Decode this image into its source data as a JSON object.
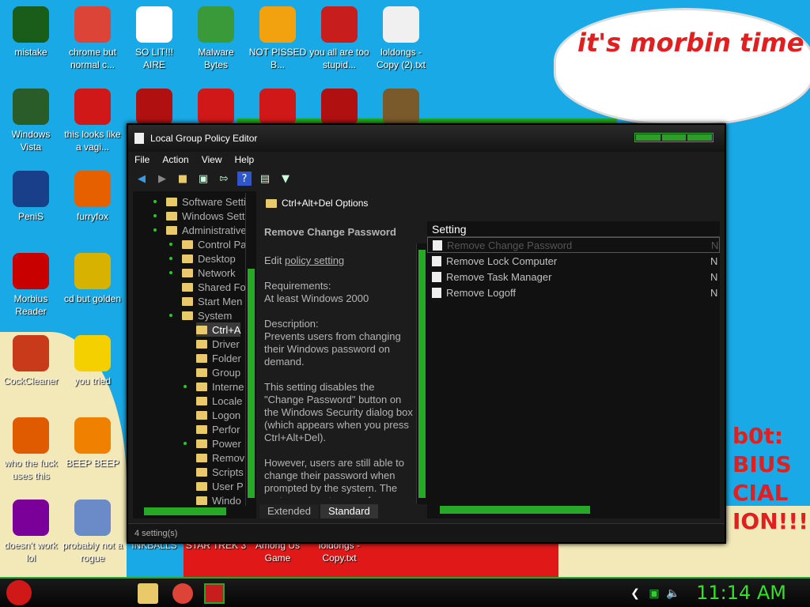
{
  "desktop": {
    "bubble_text": "it's morbin time",
    "red_lines": [
      "b0t:",
      "BIUS",
      "CIAL",
      "ION!!!"
    ],
    "icons": [
      {
        "label": "mistake",
        "icon": "green-orb-icon",
        "color": "#1a5c1a"
      },
      {
        "label": "chrome but normal c...",
        "icon": "chrome-icon",
        "color": "#db4437"
      },
      {
        "label": "SO LIT!!! AIRE",
        "icon": "solitaire-icon",
        "color": "#ffffff"
      },
      {
        "label": "Malware Bytes",
        "icon": "shield-icon",
        "color": "#3a9a3a"
      },
      {
        "label": "NOT PISSED B...",
        "icon": "angry-pig-icon",
        "color": "#f2a20e"
      },
      {
        "label": "you all are too stupid...",
        "icon": "devcpp-icon",
        "color": "#c81d1d"
      },
      {
        "label": "loldongs - Copy (2).txt",
        "icon": "text-file-icon",
        "color": "#f0f0f0"
      },
      {
        "label": "Windows Vista",
        "icon": "recycle-icon",
        "color": "#2a5c2a"
      },
      {
        "label": "this looks like a vagi...",
        "icon": "opera-icon",
        "color": "#d01818"
      },
      {
        "label": "PeniS",
        "icon": "photoshop-icon",
        "color": "#1a3f8a"
      },
      {
        "label": "furryfox",
        "icon": "firefox-icon",
        "color": "#e66000"
      },
      {
        "label": "Morbius Reader",
        "icon": "pdf-icon",
        "color": "#c80000"
      },
      {
        "label": "cd but golden",
        "icon": "cd-icon",
        "color": "#d8b200"
      },
      {
        "label": "CockCleaner",
        "icon": "ccleaner-icon",
        "color": "#c83a1a"
      },
      {
        "label": "you tried",
        "icon": "star-icon",
        "color": "#f4d000"
      },
      {
        "label": "who the fuck uses this",
        "icon": "lightning-icon",
        "color": "#e05a00"
      },
      {
        "label": "BEEP BEEP",
        "icon": "vlc-icon",
        "color": "#f08000"
      },
      {
        "label": "doesn't work lol",
        "icon": "yahoo-icon",
        "color": "#7b0099"
      },
      {
        "label": "probably not a rogue",
        "icon": "gears-icon",
        "color": "#6a8ac8"
      },
      {
        "label": "INKBALLS",
        "icon": "inkball-icon",
        "color": "#333333"
      },
      {
        "label": "STAR TREK 3",
        "icon": "startrek-icon",
        "color": "#444444"
      },
      {
        "label": "Among Us Game",
        "icon": "amongus-icon",
        "color": "#c81d1d"
      },
      {
        "label": "loldongs - Copy.txt",
        "icon": "text-file-icon",
        "color": "#f0f0f0"
      },
      {
        "label": "",
        "icon": "flash-icon",
        "color": "#b01010"
      },
      {
        "label": "",
        "icon": "angry-bird-icon",
        "color": "#d01818"
      },
      {
        "label": "",
        "icon": "angry-bird-icon",
        "color": "#d01818"
      },
      {
        "label": "",
        "icon": "emblem-icon",
        "color": "#b01010"
      },
      {
        "label": "",
        "icon": "toolbox-icon",
        "color": "#7a5a2a"
      }
    ]
  },
  "window": {
    "title": "Local Group Policy Editor",
    "menu": [
      "File",
      "Action",
      "View",
      "Help"
    ],
    "toolbar": [
      "back-arrow-icon",
      "forward-arrow-icon",
      "folder-up-icon",
      "show-hide-icon",
      "export-list-icon",
      "help-icon",
      "properties-icon",
      "filter-icon"
    ],
    "tree": [
      {
        "label": "Software Setti",
        "depth": 0,
        "dot": true
      },
      {
        "label": "Windows Setti",
        "depth": 0,
        "dot": true
      },
      {
        "label": "Administrative",
        "depth": 0,
        "dot": true
      },
      {
        "label": "Control Pa",
        "depth": 1,
        "dot": true
      },
      {
        "label": "Desktop",
        "depth": 1,
        "dot": true
      },
      {
        "label": "Network",
        "depth": 1,
        "dot": true
      },
      {
        "label": "Shared Fo",
        "depth": 1,
        "dot": false
      },
      {
        "label": "Start Men",
        "depth": 1,
        "dot": false
      },
      {
        "label": "System",
        "depth": 1,
        "dot": true
      },
      {
        "label": "Ctrl+A",
        "depth": 2,
        "dot": false
      },
      {
        "label": "Driver",
        "depth": 2,
        "dot": false
      },
      {
        "label": "Folder",
        "depth": 2,
        "dot": false
      },
      {
        "label": "Group",
        "depth": 2,
        "dot": false
      },
      {
        "label": "Interne",
        "depth": 2,
        "dot": true
      },
      {
        "label": "Locale",
        "depth": 2,
        "dot": false
      },
      {
        "label": "Logon",
        "depth": 2,
        "dot": false
      },
      {
        "label": "Perfor",
        "depth": 2,
        "dot": false
      },
      {
        "label": "Power",
        "depth": 2,
        "dot": true
      },
      {
        "label": "Remov",
        "depth": 2,
        "dot": false
      },
      {
        "label": "Scripts",
        "depth": 2,
        "dot": false
      },
      {
        "label": "User P",
        "depth": 2,
        "dot": false
      },
      {
        "label": "Windo",
        "depth": 2,
        "dot": false
      }
    ],
    "breadcrumb": "Ctrl+Alt+Del Options",
    "description": {
      "heading": "Remove Change Password",
      "edit_prefix": "Edit ",
      "edit_link": "policy setting",
      "requirements": [
        "Requirements:",
        "At least Windows 2000"
      ],
      "description": [
        "Description:",
        "Prevents users from changing their Windows password on demand."
      ],
      "body1": "This setting disables the \"Change Password\" button on the Windows Security dialog box (which appears when you press Ctrl+Alt+Del).",
      "body2": "However, users are still able to change their password when prompted by the system. The system prompts users for a"
    },
    "list": {
      "column": "Setting",
      "state_col": "N",
      "items": [
        "Remove Change Password",
        "Remove Lock Computer",
        "Remove Task Manager",
        "Remove Logoff"
      ]
    },
    "tabs": [
      "Extended",
      "Standard"
    ],
    "status": "4 setting(s)"
  },
  "taskbar": {
    "start_icon": "angry-bird-start-icon",
    "apps": [
      "explorer-icon",
      "chrome-icon",
      "gpedit-icon"
    ],
    "tray": [
      "chevron-icon",
      "network-icon",
      "volume-icon"
    ],
    "clock": "11:14 AM"
  }
}
